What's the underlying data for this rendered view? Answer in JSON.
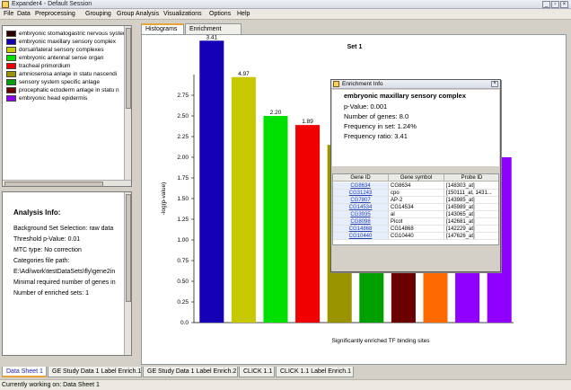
{
  "app": {
    "title": "Expander4 - Default Session"
  },
  "menu": [
    "File",
    "Data",
    "Preprocessing",
    "Grouping",
    "Group Analysis",
    "Visualizations",
    "Options",
    "Help"
  ],
  "legend": {
    "items": [
      {
        "label": "embryonic stomatogastric nervous system",
        "color": "#2b0000"
      },
      {
        "label": "embryonic maxillary sensory complex",
        "color": "#1500b5"
      },
      {
        "label": "dorsal/lateral sensory complexes",
        "color": "#c8c800"
      },
      {
        "label": "embryonic antennal sense organ",
        "color": "#00e000"
      },
      {
        "label": "tracheal primordium",
        "color": "#f00000"
      },
      {
        "label": "amnioserosa anlage in statu nascendi",
        "color": "#9a9400"
      },
      {
        "label": "sensory system specific anlage",
        "color": "#00a000"
      },
      {
        "label": "procephalic ectoderm anlage in statu n",
        "color": "#6a0000"
      },
      {
        "label": "embryonic head epidermis",
        "color": "#9000ff"
      }
    ]
  },
  "analysis": {
    "title": "Analysis Info:",
    "lines": [
      "Background Set Selection: raw data",
      "Threshold p-Value: 0.01",
      "MTC type: No correction",
      "Categories file path:",
      "E:\\Adi\\work\\testDataSets\\fly\\gene2in",
      "Minimal required number of genes in",
      "Number of enriched sets: 1"
    ]
  },
  "tabs": {
    "histograms": "Histograms",
    "enrichment_table": "Enrichment Table"
  },
  "chart_data": {
    "type": "bar",
    "title": "Set 1",
    "xlabel": "Significantly enriched TF binding sites",
    "ylabel": "-log(p-value)",
    "ylim": [
      0,
      3.0
    ],
    "yticks": [
      "0.0",
      "0.25",
      "0.50",
      "0.75",
      "1.00",
      "1.25",
      "1.50",
      "1.75",
      "2.00",
      "2.25",
      "2.50",
      "2.75"
    ],
    "values": [
      3.41,
      2.97,
      2.5,
      2.39,
      2.15,
      2.15,
      2.15,
      2.15,
      2.15,
      2.0
    ],
    "bar_labels": [
      "3.41",
      "4.97",
      "2.20",
      "1.89",
      "",
      "",
      "",
      "",
      "",
      ""
    ],
    "colors": [
      "#1500b5",
      "#c8c800",
      "#00e000",
      "#f00000",
      "#9a9400",
      "#00a000",
      "#6a0000",
      "#ff6a00",
      "#9000ff",
      "#9000ff"
    ]
  },
  "dialog": {
    "title": "Enrichment Info",
    "heading": "embryonic maxillary sensory complex",
    "lines": [
      "p-Value: 0.001",
      "Number of genes: 8.0",
      "Frequency in set: 1.24%",
      "Frequency ratio: 3.41"
    ],
    "columns": [
      "Gene ID",
      "Gene symbol",
      "Probe ID"
    ],
    "rows": [
      [
        "CG8634",
        "CG8634",
        "[148303_at]"
      ],
      [
        "CG31243",
        "cpo",
        "[150111_at, 1431..."
      ],
      [
        "CG7807",
        "AP-2",
        "[143985_at]"
      ],
      [
        "CG14534",
        "CG14534",
        "[145989_at]"
      ],
      [
        "CG3935",
        "al",
        "[143065_at]"
      ],
      [
        "CG8098",
        "Picot",
        "[142681_at]"
      ],
      [
        "CG14868",
        "CG14868",
        "[142229_at]"
      ],
      [
        "CG10440",
        "CG10440",
        "[147626_at]"
      ]
    ]
  },
  "bottom_tabs": [
    "Data Sheet 1",
    "GE Study Data 1 Label Enrich.1",
    "GE Study Data 1 Label Enrich.2",
    "CLICK 1.1",
    "CLICK 1.1 Label Enrich.1"
  ],
  "status": "Currently working on: Data Sheet 1"
}
